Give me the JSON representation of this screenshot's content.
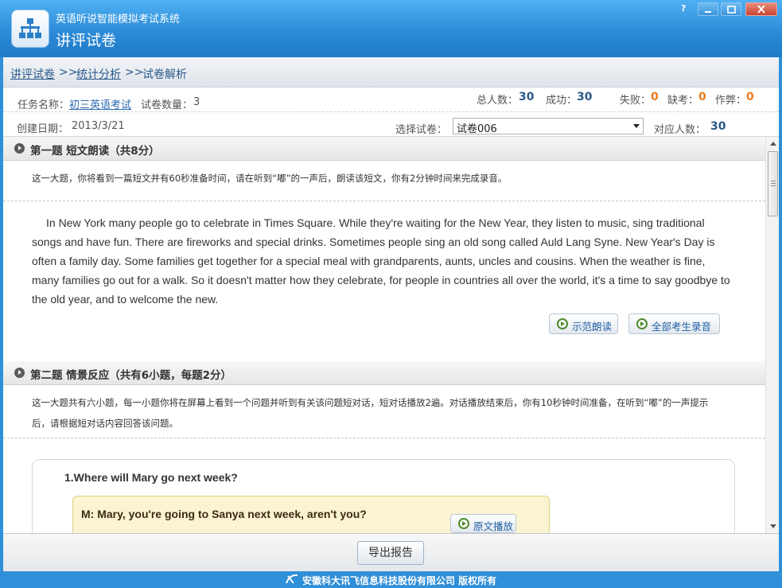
{
  "window": {
    "app_name": "英语听说智能模拟考试系统",
    "title": "讲评试卷",
    "controls": {
      "help": "?"
    }
  },
  "breadcrumb": {
    "items": [
      "讲评试卷",
      "统计分析",
      "试卷解析"
    ],
    "separator": ">>"
  },
  "info": {
    "task_label": "任务名称：",
    "task_value": "初三英语考试",
    "count_label": "试卷数量：",
    "count_value": "3",
    "date_label": "创建日期：",
    "date_value": "2013/3/21",
    "total_label": "总人数：",
    "total_value": "30",
    "success_label": "成功：",
    "success_value": "30",
    "fail_label": "失败：",
    "fail_value": "0",
    "absent_label": "缺考：",
    "absent_value": "0",
    "cheat_label": "作弊：",
    "cheat_value": "0",
    "select_label": "选择试卷：",
    "select_value": "试卷006",
    "match_label": "对应人数：",
    "match_value": "30"
  },
  "section1": {
    "title": "第一题 短文朗读（共8分）",
    "desc": "这一大题，你将看到一篇短文并有60秒准备时间，请在听到“嘟”的一声后，朗读该短文，你有2分钟时间来完成录音。",
    "passage": "In New York many people go to celebrate in Times Square. While they're waiting for the New Year, they listen to music, sing traditional songs and have fun. There are fireworks and special drinks. Sometimes people sing an old song called Auld Lang Syne. New Year's Day is often a family day. Some families get together for a special meal with grandparents, aunts, uncles and cousins. When the weather is fine, many families go out for a walk. So it doesn't matter how they celebrate, for people in countries all over the world, it's a time to say goodbye to the old year, and to welcome the new.",
    "demo_button": "示范朗读",
    "all_button": "全部考生录音"
  },
  "section2": {
    "title": "第二题 情景反应（共有6小题，每题2分）",
    "desc": "这一大题共有六小题，每一小题你将在屏幕上看到一个问题并听到有关该问题短对话，短对话播放2遍。对话播放结束后，你有10秒钟时间准备，在听到“嘟”的一声提示后，请根据短对话内容回答该问题。",
    "question": "1.Where will Mary go next week?",
    "dialog_line": "M: Mary, you're going to Sanya next week, aren't you?",
    "play_button": "原文播放"
  },
  "footer": {
    "export_button": "导出报告",
    "copyright": "安徽科大讯飞信息科技股份有限公司 版权所有"
  },
  "colors": {
    "titlebar": "#2a89d6",
    "link": "#2b5a8c",
    "number_ok": "#2b5a8c",
    "number_warn": "#e87c1e"
  }
}
